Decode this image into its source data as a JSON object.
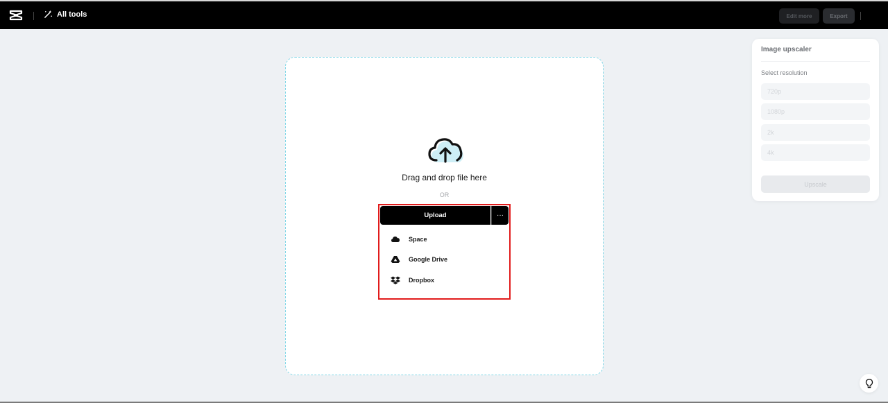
{
  "topbar": {
    "all_tools_label": "All tools",
    "edit_more_label": "Edit more",
    "export_label": "Export"
  },
  "dropzone": {
    "drag_text": "Drag and drop file here",
    "or_text": "OR"
  },
  "upload": {
    "upload_label": "Upload",
    "more_label": "···",
    "menu": [
      {
        "label": "Space",
        "icon": "cloud-icon"
      },
      {
        "label": "Google Drive",
        "icon": "google-drive-icon"
      },
      {
        "label": "Dropbox",
        "icon": "dropbox-icon"
      }
    ]
  },
  "panel": {
    "title": "Image upscaler",
    "subtitle": "Select resolution",
    "resolutions": [
      "720p",
      "1080p",
      "2k",
      "4k"
    ],
    "upscale_label": "Upscale"
  },
  "colors": {
    "accent_border": "#7fd6e6",
    "highlight": "#e11b1b",
    "topbar": "#000000"
  }
}
